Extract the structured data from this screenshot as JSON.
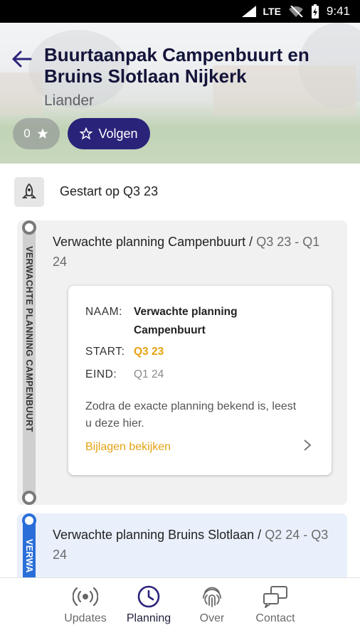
{
  "status_bar": {
    "network": "LTE",
    "time": "9:41"
  },
  "header": {
    "title": "Buurtaanpak Campenbuurt en Bruins Slotlaan Nijkerk",
    "subtitle": "Liander",
    "favorite_count": "0",
    "follow_label": "Volgen",
    "accent_color": "#2a237a"
  },
  "started": {
    "label": "Gestart op Q3 23"
  },
  "phases": [
    {
      "rail_label": "VERWACHTE PLANNING CAMPENBUURT",
      "title": "Verwachte planning Campenbuurt / ",
      "period": "Q3 23 - Q1 24",
      "card": {
        "name_label": "NAAM:",
        "name_value": "Verwachte planning Campenbuurt",
        "start_label": "START:",
        "start_value": "Q3 23",
        "end_label": "EIND:",
        "end_value": "Q1 24",
        "description": "Zodra de exacte planning bekend is, leest u deze hier.",
        "attachments_label": "Bijlagen bekijken"
      }
    },
    {
      "rail_label": "VERWA",
      "title": "Verwachte planning Bruins Slotlaan / ",
      "period": "Q2 24 - Q3 24"
    }
  ],
  "bottom_nav": [
    {
      "label": "Updates",
      "icon": "broadcast-icon"
    },
    {
      "label": "Planning",
      "icon": "clock-icon",
      "active": true
    },
    {
      "label": "Over",
      "icon": "fingerprint-icon"
    },
    {
      "label": "Contact",
      "icon": "chat-bubbles-icon"
    }
  ],
  "colors": {
    "highlight": "#e5a213",
    "active_rail": "#2a6fd9"
  }
}
